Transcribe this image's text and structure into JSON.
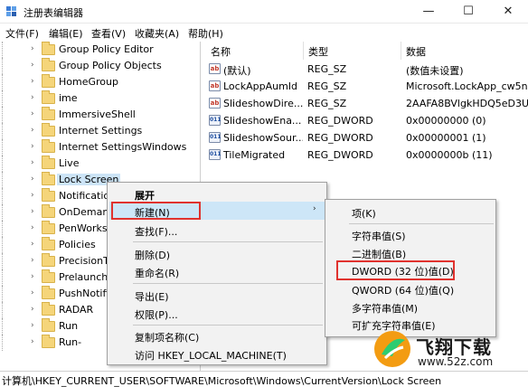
{
  "window": {
    "title": "注册表编辑器",
    "minimize_glyph": "—",
    "maximize_glyph": "☐",
    "close_glyph": "✕",
    "icon": "regedit-icon"
  },
  "menubar": [
    "文件(F)",
    "编辑(E)",
    "查看(V)",
    "收藏夹(A)",
    "帮助(H)"
  ],
  "tree": {
    "items": [
      {
        "label": "Group Policy Editor"
      },
      {
        "label": "Group Policy Objects"
      },
      {
        "label": "HomeGroup"
      },
      {
        "label": "ime"
      },
      {
        "label": "ImmersiveShell"
      },
      {
        "label": "Internet Settings"
      },
      {
        "label": "Internet SettingsWindows"
      },
      {
        "label": "Live"
      },
      {
        "label": "Lock Screen",
        "selected": true
      },
      {
        "label": "Notificatio"
      },
      {
        "label": "OnDemand"
      },
      {
        "label": "PenWorks"
      },
      {
        "label": "Policies"
      },
      {
        "label": "PrecisionT"
      },
      {
        "label": "Prelaunch"
      },
      {
        "label": "PushNotifi"
      },
      {
        "label": "RADAR"
      },
      {
        "label": "Run"
      },
      {
        "label": "Run-"
      }
    ]
  },
  "list": {
    "columns": [
      "名称",
      "类型",
      "数据"
    ],
    "rows": [
      {
        "icon": "ab",
        "name": "(默认)",
        "type": "REG_SZ",
        "data": "(数值未设置)"
      },
      {
        "icon": "ab",
        "name": "LockAppAumId",
        "type": "REG_SZ",
        "data": "Microsoft.LockApp_cw5n1"
      },
      {
        "icon": "ab",
        "name": "SlideshowDire...",
        "type": "REG_SZ",
        "data": "2AAFA8BVlgkHDQ5eD3U"
      },
      {
        "icon": "dword",
        "name": "SlideshowEna...",
        "type": "REG_DWORD",
        "data": "0x00000000 (0)"
      },
      {
        "icon": "dword",
        "name": "SlideshowSour...",
        "type": "REG_DWORD",
        "data": "0x00000001 (1)"
      },
      {
        "icon": "dword",
        "name": "TileMigrated",
        "type": "REG_DWORD",
        "data": "0x0000000b (11)"
      }
    ]
  },
  "context_menu": {
    "items": [
      "展开",
      "新建(N)",
      "查找(F)...",
      "删除(D)",
      "重命名(R)",
      "导出(E)",
      "权限(P)...",
      "复制项名称(C)",
      "访问 HKEY_LOCAL_MACHINE(T)"
    ],
    "highlighted": "新建(N)",
    "submenu_arrow": "›"
  },
  "submenu": {
    "items": [
      "项(K)",
      "字符串值(S)",
      "二进制值(B)",
      "DWORD (32 位)值(D)",
      "QWORD (64 位)值(Q)",
      "多字符串值(M)",
      "可扩充字符串值(E)"
    ],
    "highlighted": "DWORD (32 位)值(D)"
  },
  "statusbar": {
    "path": "计算机\\HKEY_CURRENT_USER\\SOFTWARE\\Microsoft\\Windows\\CurrentVersion\\Lock Screen"
  },
  "watermark": {
    "title": "飞翔下载",
    "url": "www.52z.com"
  },
  "colors": {
    "highlight": "#cde6f7",
    "annotation_box": "#e0322e",
    "folder": "#f5d57a"
  }
}
